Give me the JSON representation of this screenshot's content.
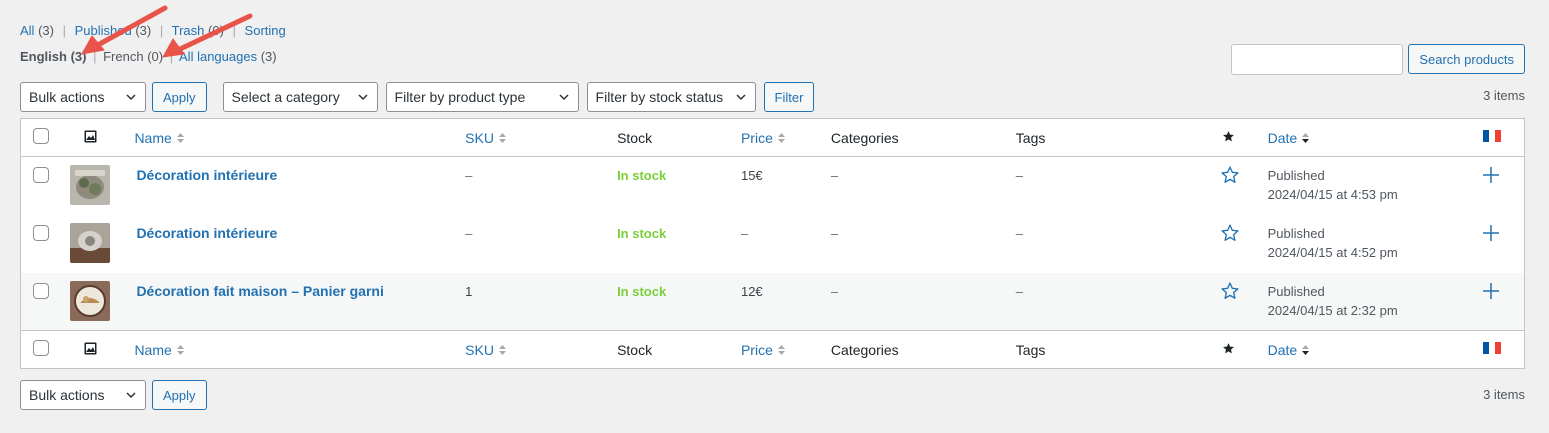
{
  "views": {
    "all": {
      "label": "All",
      "count": "(3)"
    },
    "published": {
      "label": "Published",
      "count": "(3)"
    },
    "trash": {
      "label": "Trash",
      "count": "(0)"
    },
    "sorting": {
      "label": "Sorting"
    }
  },
  "languages": {
    "english": {
      "label": "English",
      "count": "(3)"
    },
    "french": {
      "label": "French",
      "count": "(0)"
    },
    "all": {
      "label": "All languages",
      "count": "(3)"
    }
  },
  "search": {
    "value": "",
    "placeholder": "",
    "button": "Search products"
  },
  "tablenav_top": {
    "bulk_actions": "Bulk actions",
    "apply": "Apply",
    "category": "Select a category",
    "product_type": "Filter by product type",
    "stock_status": "Filter by stock status",
    "filter": "Filter",
    "items": "3 items"
  },
  "tablenav_bottom": {
    "bulk_actions": "Bulk actions",
    "apply": "Apply",
    "items": "3 items"
  },
  "columns": {
    "name": "Name",
    "sku": "SKU",
    "stock": "Stock",
    "price": "Price",
    "categories": "Categories",
    "tags": "Tags",
    "date": "Date"
  },
  "rows": [
    {
      "name": "Décoration intérieure",
      "sku": "–",
      "stock": "In stock",
      "price": "15€",
      "categories": "–",
      "tags": "–",
      "status": "Published",
      "date": "2024/04/15 at 4:53 pm"
    },
    {
      "name": "Décoration intérieure",
      "sku": "–",
      "stock": "In stock",
      "price": "–",
      "categories": "–",
      "tags": "–",
      "status": "Published",
      "date": "2024/04/15 at 4:52 pm"
    },
    {
      "name": "Décoration fait maison – Panier garni",
      "sku": "1",
      "stock": "In stock",
      "price": "12€",
      "categories": "–",
      "tags": "–",
      "status": "Published",
      "date": "2024/04/15 at 2:32 pm"
    }
  ],
  "icons": {
    "image_column": "image-icon",
    "featured": "star-icon",
    "language_flag": "french-flag-icon",
    "add_translation": "plus-icon",
    "annotation": "red-arrow-icon"
  },
  "colors": {
    "link": "#2271b1",
    "in_stock": "#7ad03a",
    "arrow": "#e8534a",
    "flag_blue": "#0055a4",
    "flag_red": "#ef4135"
  }
}
